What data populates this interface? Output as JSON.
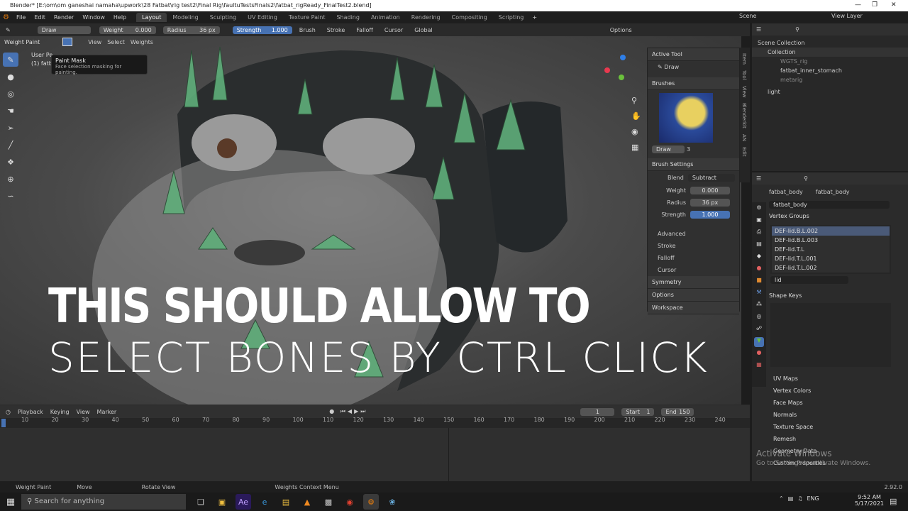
{
  "titlebar": {
    "title": "Blender* [E:\\om\\om ganeshai namaha\\upwork\\28 Fatbat\\rig test2\\Final Rig\\faultuTestsFinals2\\fatbat_rigReady_FinalTest2.blend]"
  },
  "menu": [
    "File",
    "Edit",
    "Render",
    "Window",
    "Help"
  ],
  "workspaces": [
    "Layout",
    "Modeling",
    "Sculpting",
    "UV Editing",
    "Texture Paint",
    "Shading",
    "Animation",
    "Rendering",
    "Compositing",
    "Scripting"
  ],
  "scene": "Scene",
  "view_layer": "View Layer",
  "header": {
    "brush": "Draw",
    "weight_label": "Weight",
    "weight": "0.000",
    "radius_label": "Radius",
    "radius": "36 px",
    "strength_label": "Strength",
    "strength": "1.000",
    "brush_menu": "Brush",
    "stroke": "Stroke",
    "falloff": "Falloff",
    "cursor": "Cursor",
    "global": "Global",
    "options": "Options"
  },
  "header2": {
    "mode": "Weight Paint",
    "view": "View",
    "select": "Select",
    "weights": "Weights"
  },
  "tooltip": {
    "title": "Paint Mask",
    "desc": "Face selection masking for painting."
  },
  "viewport": {
    "user_persp": "User Pe",
    "object": "(1) fatb"
  },
  "npanel": {
    "active_tool": "Active Tool",
    "draw": "Draw",
    "brushes": "Brushes",
    "brush_name": "Draw",
    "brush_users": "3",
    "brush_settings": "Brush Settings",
    "blend_label": "Blend",
    "blend": "Subtract",
    "weight_label": "Weight",
    "weight": "0.000",
    "radius_label": "Radius",
    "radius": "36 px",
    "strength_label": "Strength",
    "strength": "1.000",
    "advanced": "Advanced",
    "stroke": "Stroke",
    "falloff": "Falloff",
    "cursor": "Cursor",
    "symmetry": "Symmetry",
    "options": "Options",
    "workspace": "Workspace"
  },
  "vtabs": [
    "Item",
    "Tool",
    "View",
    "Blenderkit",
    "AN",
    "Edit"
  ],
  "caption": {
    "line1": "THIS SHOULD ALLOW TO",
    "line2": "SELECT BONES BY CTRL CLICK"
  },
  "outliner": {
    "scene_collection": "Scene Collection",
    "collection": "Collection",
    "items": [
      "WGTS_rig",
      "fatbat_inner_stomach",
      "metarig"
    ],
    "light": "light"
  },
  "props": {
    "object": "fatbat_body",
    "mesh": "fatbat_body",
    "mesh_data": "fatbat_body",
    "vertex_groups": "Vertex Groups",
    "groups": [
      "DEF-lid.B.L.002",
      "DEF-lid.B.L.003",
      "DEF-lid.T.L",
      "DEF-lid.T.L.001",
      "DEF-lid.T.L.002"
    ],
    "filter": "lid",
    "shape_keys": "Shape Keys",
    "sections": [
      "UV Maps",
      "Vertex Colors",
      "Face Maps",
      "Normals",
      "Texture Space",
      "Remesh",
      "Geometry Data",
      "Custom Properties"
    ],
    "version": "2.92.0"
  },
  "timeline": {
    "playback": "Playback",
    "keying": "Keying",
    "view": "View",
    "marker": "Marker",
    "frame": "1",
    "start_label": "Start",
    "start": "1",
    "end_label": "End",
    "end": "150",
    "ticks": [
      "10",
      "20",
      "30",
      "40",
      "50",
      "60",
      "70",
      "80",
      "90",
      "100",
      "110",
      "120",
      "130",
      "140",
      "150",
      "160",
      "170",
      "180",
      "190",
      "200",
      "210",
      "220",
      "230",
      "240"
    ]
  },
  "status": {
    "left": "Weight Paint",
    "move": "Move",
    "rotate": "Rotate View",
    "context": "Weights Context Menu"
  },
  "taskbar": {
    "search": "Search for anything",
    "lang": "ENG",
    "time": "9:52 AM",
    "date": "5/17/2021"
  },
  "watermark": {
    "line1": "Activate Windows",
    "line2": "Go to Settings to activate Windows."
  }
}
